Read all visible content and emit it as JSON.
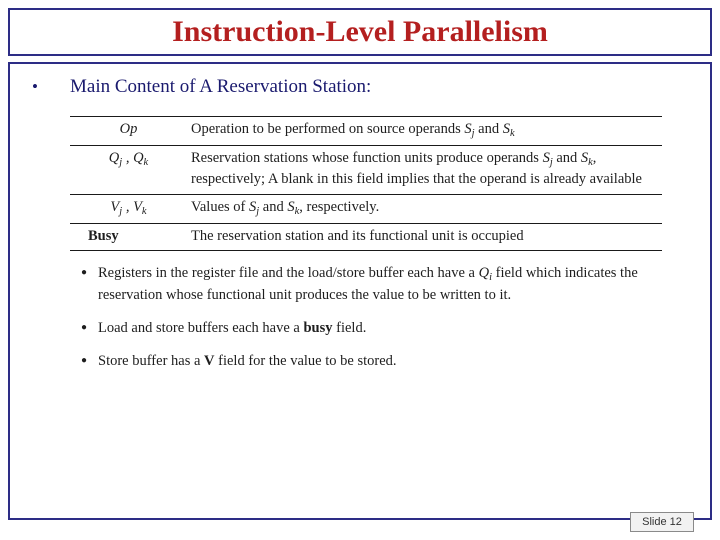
{
  "slide": {
    "title": "Instruction-Level Parallelism",
    "main_bullet": {
      "marker": "•",
      "text": "Main Content of A Reservation Station:"
    },
    "table": {
      "rows": [
        {
          "label": "Op",
          "label_style": "italic",
          "desc_html": "Operation to be performed on source operands <i>S<span class=\"sub\">j</span></i> and <i>S<span class=\"sub\">k</span></i>"
        },
        {
          "label_html": "Q<span class=\"sub\">j</span> , Q<span class=\"sub\">k</span>",
          "label_style": "italic",
          "desc_html": "Reservation stations whose function units produce operands <i>S<span class=\"sub\">j</span></i> and <i>S<span class=\"sub\">k</span></i>, respectively; A blank in this field implies that the operand is already available"
        },
        {
          "label_html": "V<span class=\"sub\">j</span> , V<span class=\"sub\">k</span>",
          "label_style": "italic",
          "desc_html": "Values of <i>S<span class=\"sub\">j</span></i> and <i>S<span class=\"sub\">k</span></i>, respectively."
        },
        {
          "label": "Busy",
          "label_style": "bold",
          "desc_html": "The reservation station and its functional unit is occupied"
        }
      ]
    },
    "sub_bullets": [
      {
        "marker": "●",
        "html": "Registers in the register file and the load/store buffer each have a <i>Q<span class=\"sub\">i</span></i> field which indicates the reservation whose functional unit produces the value to be written to it."
      },
      {
        "marker": "●",
        "html": "Load and store buffers each have a <b>busy</b> field."
      },
      {
        "marker": "●",
        "html": "Store buffer has a <b>V</b> field for the value to be stored."
      }
    ],
    "slide_number": "Slide 12"
  },
  "colors": {
    "title_text": "#b41f1f",
    "frame_border": "#2d2d86",
    "bullet_text": "#1a1a6e",
    "body_text": "#1e1e1e"
  }
}
